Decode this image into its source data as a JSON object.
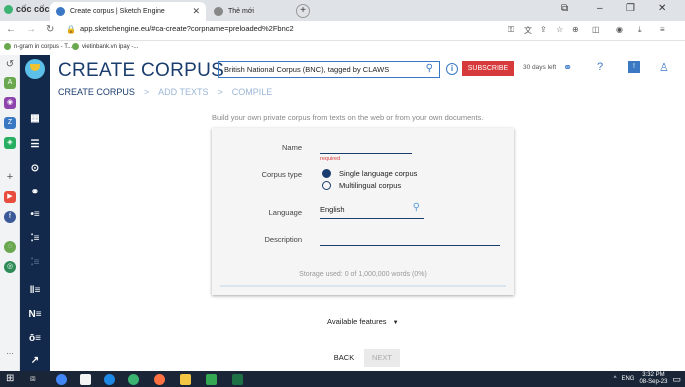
{
  "browser": {
    "logo_text": "cốc cốc",
    "tabs": [
      {
        "title": "Create corpus | Sketch Engine"
      },
      {
        "title": "Thẻ mới"
      }
    ],
    "url": "app.sketchengine.eu/#ca-create?corpname=preloaded%2Fbnc2",
    "bookmarks": [
      "n-gram in corpus - T...",
      "vietinbank.vn ipay -..."
    ]
  },
  "app": {
    "title": "CREATE CORPUS",
    "corpus_select": "British National Corpus (BNC), tagged by CLAWS",
    "subscribe_label": "SUBSCRIBE",
    "days_left": "30 days left",
    "breadcrumb": [
      "CREATE CORPUS",
      "ADD TEXTS",
      "COMPILE"
    ],
    "breadcrumb_sep": ">",
    "intro": "Build your own private corpus from texts on the web or from your own documents."
  },
  "form": {
    "name_label": "Name",
    "name_value": "",
    "name_required": "required",
    "corpus_type_label": "Corpus type",
    "corpus_type_options": [
      "Single language corpus",
      "Multilingual corpus"
    ],
    "corpus_type_selected": 0,
    "language_label": "Language",
    "language_value": "English",
    "description_label": "Description",
    "description_value": "",
    "storage_text": "Storage used: 0 of 1,000,000 words (0%)",
    "storage_fraction": 0
  },
  "footer": {
    "available_features": "Available features",
    "back_label": "BACK",
    "next_label": "NEXT"
  },
  "taskbar": {
    "lang": "ENG",
    "time": "3:32 PM",
    "date": "08-Sep-23"
  },
  "colors": {
    "brand_navy": "#12294b",
    "accent_blue": "#3a78c3",
    "subscribe_red": "#d73a3a"
  }
}
